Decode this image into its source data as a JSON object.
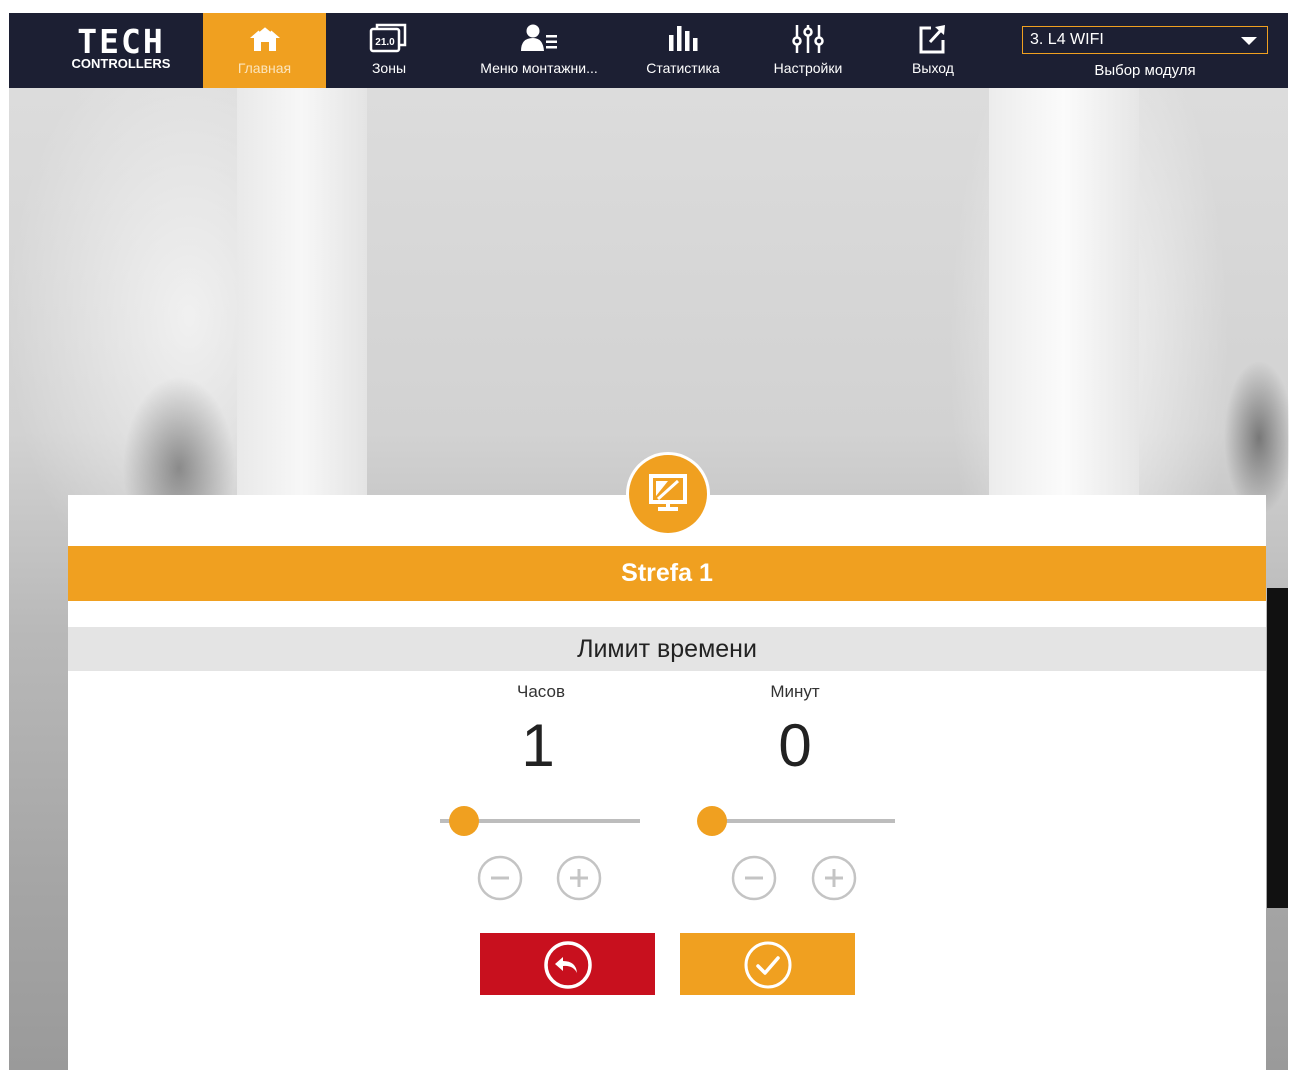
{
  "header": {
    "logo_top": "TECH",
    "logo_bottom": "CONTROLLERS",
    "nav": [
      {
        "label": "Главная",
        "icon": "home-icon",
        "active": true
      },
      {
        "label": "Зоны",
        "icon": "zones-icon",
        "badge": "21.0"
      },
      {
        "label": "Меню монтажни...",
        "icon": "installer-menu-icon"
      },
      {
        "label": "Статистика",
        "icon": "statistics-icon"
      },
      {
        "label": "Настройки",
        "icon": "settings-sliders-icon"
      },
      {
        "label": "Выход",
        "icon": "exit-icon"
      }
    ],
    "module_select": {
      "value": "3. L4 WIFI",
      "label": "Выбор модуля"
    }
  },
  "zone": {
    "name": "Strefa 1",
    "icon": "display-icon"
  },
  "time_limit": {
    "title": "Лимит времени",
    "hours": {
      "label": "Часов",
      "value": "1",
      "slider_fraction": 0.12
    },
    "minutes": {
      "label": "Минут",
      "value": "0",
      "slider_fraction": 0.0
    }
  },
  "buttons": {
    "cancel_icon": "undo-icon",
    "confirm_icon": "check-icon"
  },
  "colors": {
    "accent": "#f0a020",
    "navbar": "#1c1f33",
    "cancel": "#c8101e"
  }
}
